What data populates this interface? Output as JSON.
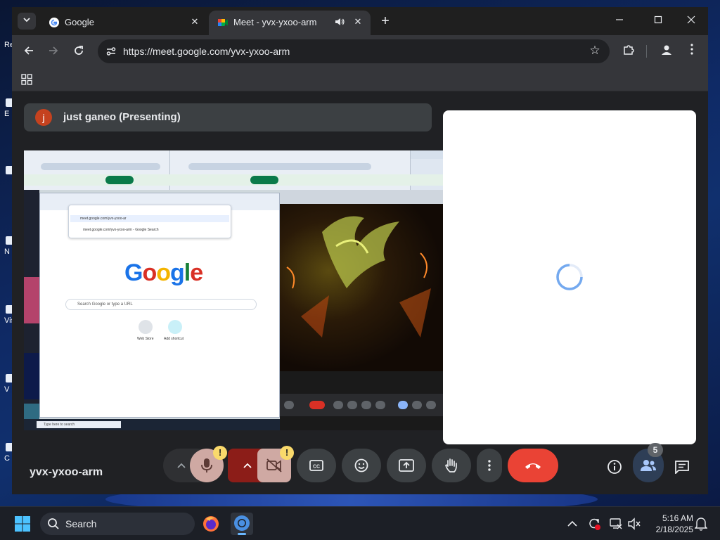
{
  "desktop": {
    "edge_labels": [
      "Re",
      "E",
      "N",
      "Vis",
      "V",
      "C"
    ]
  },
  "browser": {
    "tabs": [
      {
        "title": "Google",
        "active": false
      },
      {
        "title": "Meet - yvx-yxoo-arm",
        "active": true
      }
    ],
    "url": "https://meet.google.com/yvx-yxoo-arm"
  },
  "meet": {
    "presenter": {
      "initial": "j",
      "label": "just ganeo (Presenting)"
    },
    "shared_screen": {
      "omnibox_suggestions": [
        "meet.google.com/yvx-yxoo-ar",
        "meet.google.com/yvx-yxoo-arm - Google Search"
      ],
      "google_logo_letters": [
        "G",
        "o",
        "o",
        "g",
        "l",
        "e"
      ],
      "search_placeholder": "Search Google or type a URL",
      "shortcuts": [
        "Web Store",
        "Add shortcut"
      ],
      "taskbar_search": "Type here to search"
    },
    "meeting_code": "yvx-yxoo-arm",
    "warning_mark": "!",
    "participant_count": "5",
    "colors": {
      "end_call": "#ea4335",
      "mic_muted_bg": "#cfa9a3",
      "warning": "#f9d96b",
      "avatar": "#c5421f"
    }
  },
  "taskbar": {
    "search_label": "Search",
    "time": "5:16 AM",
    "date": "2/18/2025"
  }
}
